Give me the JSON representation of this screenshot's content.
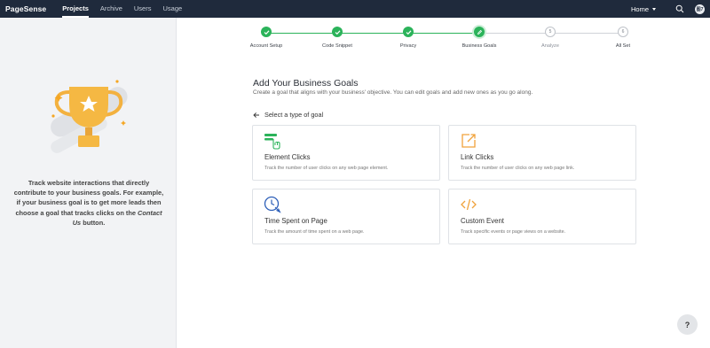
{
  "brand": "PageSense",
  "nav": [
    "Projects",
    "Archive",
    "Users",
    "Usage"
  ],
  "home": "Home",
  "avatar_text": "图7",
  "sidebar": {
    "text_1": "Track website interactions that directly contribute to your business goals. For example, if your business goal is to get more leads then choose a goal that tracks clicks on the ",
    "text_italic": "Contact Us",
    "text_2": " button."
  },
  "steps": [
    {
      "label": "Account Setup",
      "state": "done"
    },
    {
      "label": "Code Snippet",
      "state": "done"
    },
    {
      "label": "Privacy",
      "state": "done"
    },
    {
      "label": "Business Goals",
      "state": "current"
    },
    {
      "label": "Analyze",
      "state": "todo",
      "num": "5"
    },
    {
      "label": "All Set",
      "state": "todo",
      "num": "6"
    }
  ],
  "main": {
    "title": "Add Your Business Goals",
    "subtitle": "Create a goal that aligns with your business' objective. You can edit goals and add new ones as you go along.",
    "select_label": "Select a type of goal"
  },
  "cards": [
    {
      "title": "Element Clicks",
      "desc": "Track the number of user clicks on any web page element.",
      "icon": "element-click-icon"
    },
    {
      "title": "Link Clicks",
      "desc": "Track the number of user clicks on any web page link.",
      "icon": "link-click-icon"
    },
    {
      "title": "Time Spent on Page",
      "desc": "Track the amount of time spent on a web page.",
      "icon": "clock-icon"
    },
    {
      "title": "Custom Event",
      "desc": "Track specific events or page views on a website.",
      "icon": "code-icon"
    }
  ],
  "help": "?",
  "colors": {
    "topbar": "#1f2a3c",
    "accent_green": "#2bb35a",
    "icon_orange": "#f0a23b",
    "icon_green": "#2bb35a",
    "icon_blue": "#2d5fb8"
  }
}
